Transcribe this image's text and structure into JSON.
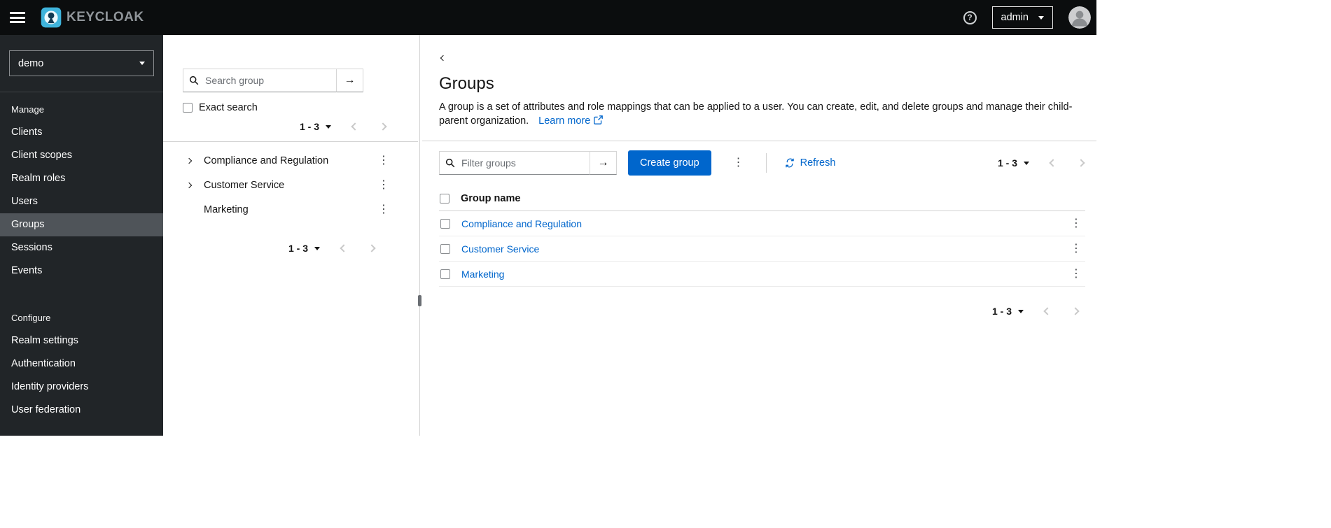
{
  "topbar": {
    "brand": "KEYCLOAK",
    "user_label": "admin"
  },
  "sidebar": {
    "realm": "demo",
    "manage_header": "Manage",
    "manage_items": [
      "Clients",
      "Client scopes",
      "Realm roles",
      "Users",
      "Groups",
      "Sessions",
      "Events"
    ],
    "selected_item": "Groups",
    "configure_header": "Configure",
    "configure_items": [
      "Realm settings",
      "Authentication",
      "Identity providers",
      "User federation"
    ]
  },
  "tree_panel": {
    "search_placeholder": "Search group",
    "exact_search_label": "Exact search",
    "pagination_top_range": "1 - 3",
    "items": [
      {
        "label": "Compliance and Regulation",
        "expandable": true
      },
      {
        "label": "Customer Service",
        "expandable": true
      },
      {
        "label": "Marketing",
        "expandable": false
      }
    ],
    "pagination_bottom_range": "1 - 3"
  },
  "main": {
    "title": "Groups",
    "description": "A group is a set of attributes and role mappings that can be applied to a user. You can create, edit, and delete groups and manage their child-parent organization.",
    "learn_more_label": "Learn more",
    "toolbar": {
      "filter_placeholder": "Filter groups",
      "create_group_label": "Create group",
      "refresh_label": "Refresh",
      "pagination_range": "1 - 3"
    },
    "table": {
      "column_group_name": "Group name",
      "rows": [
        {
          "name": "Compliance and Regulation"
        },
        {
          "name": "Customer Service"
        },
        {
          "name": "Marketing"
        }
      ]
    },
    "pagination_bottom_range": "1 - 3"
  },
  "colors": {
    "primary": "#0066cc",
    "link": "#0066cc",
    "topbar_bg": "#0b0d0e",
    "sidebar_bg": "#212528",
    "sidebar_selected_bg": "#4f5459"
  }
}
